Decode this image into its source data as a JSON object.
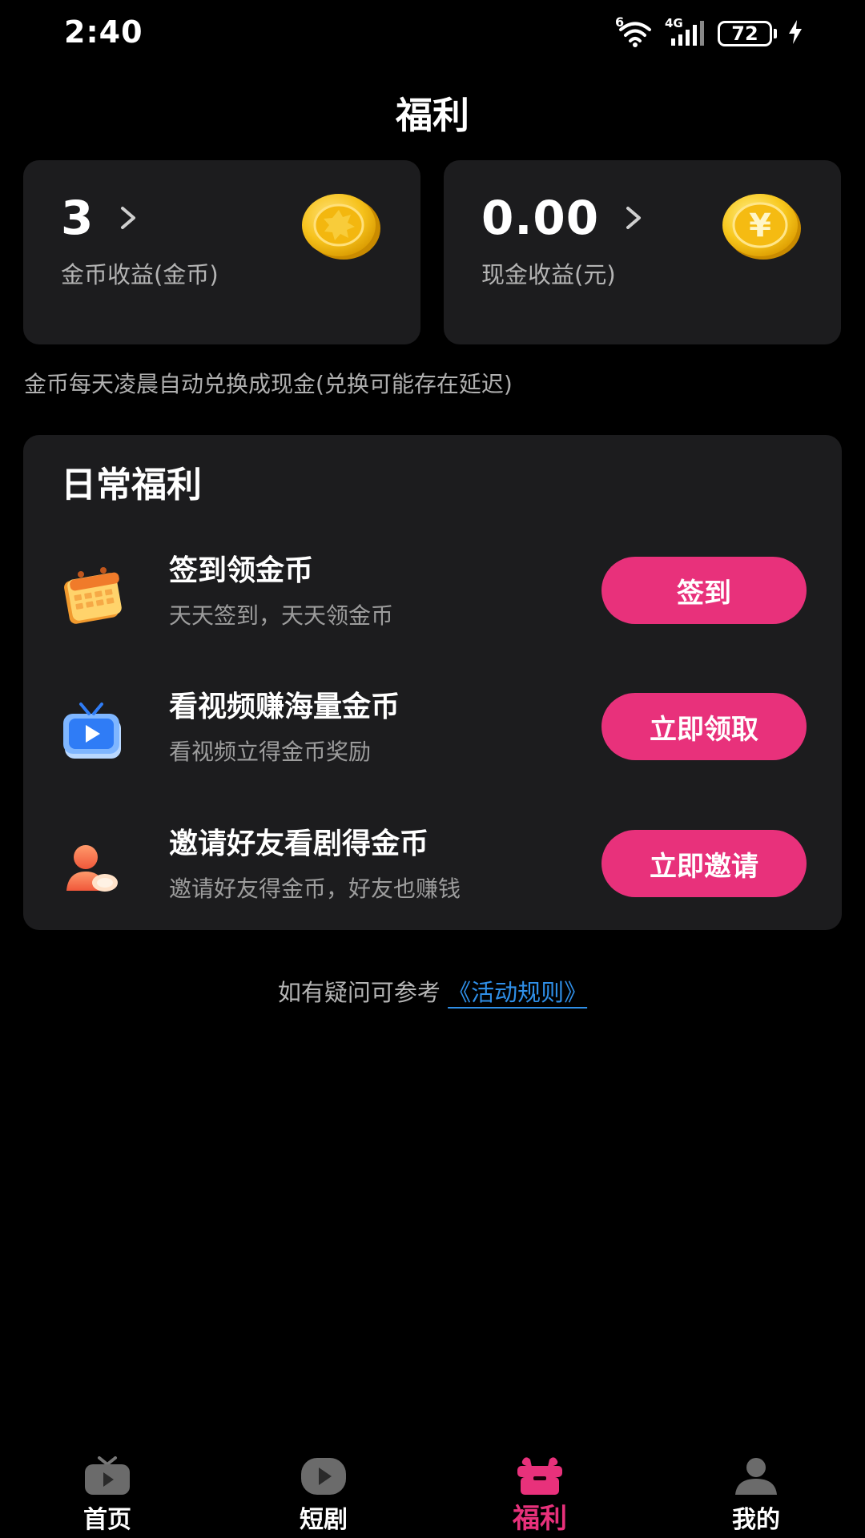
{
  "status_bar": {
    "time": "2:40",
    "wifi_badge": "6",
    "network_label": "4G",
    "battery_level": "72"
  },
  "page": {
    "title": "福利"
  },
  "earnings": {
    "coin": {
      "value": "3",
      "label": "金币收益(金币)"
    },
    "cash": {
      "value": "0.00",
      "label": "现金收益(元)",
      "symbol": "¥"
    },
    "exchange_note": "金币每天凌晨自动兑换成现金(兑换可能存在延迟)"
  },
  "daily_welfare": {
    "title": "日常福利",
    "tasks": [
      {
        "title": "签到领金币",
        "description": "天天签到，天天领金币",
        "button_label": "签到",
        "icon": "calendar-icon"
      },
      {
        "title": "看视频赚海量金币",
        "description": "看视频立得金币奖励",
        "button_label": "立即领取",
        "icon": "tv-icon"
      },
      {
        "title": "邀请好友看剧得金币",
        "description": "邀请好友得金币，好友也赚钱",
        "button_label": "立即邀请",
        "icon": "friends-icon"
      }
    ]
  },
  "rules": {
    "prefix": "如有疑问可参考",
    "link": "《活动规则》"
  },
  "bottom_nav": {
    "items": [
      {
        "label": "首页",
        "icon": "home-tv-icon",
        "active": false
      },
      {
        "label": "短剧",
        "icon": "play-icon",
        "active": false
      },
      {
        "label": "福利",
        "icon": "gift-icon",
        "active": true
      },
      {
        "label": "我的",
        "icon": "user-icon",
        "active": false
      }
    ]
  },
  "colors": {
    "background": "#000000",
    "card": "#1c1c1e",
    "accent": "#e8317b",
    "link": "#2f8fe8",
    "coin_gold": "#f5c518"
  }
}
